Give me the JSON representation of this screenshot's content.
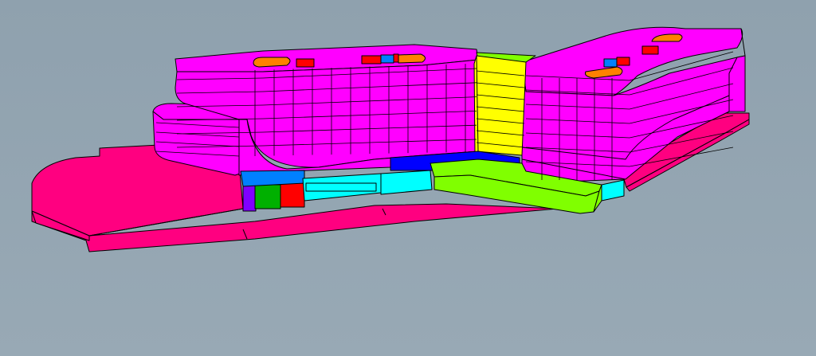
{
  "viewport": {
    "background_top": "#8fa1ae",
    "background_bottom": "#98a9b5"
  },
  "model": {
    "colors": {
      "office": "#ff00ff",
      "podium": "#ff0080",
      "circulation": "#ffff00",
      "retail": "#00ffff",
      "walkway": "#80ff00",
      "lobby": "#0000ff",
      "service": "#ff0000",
      "storage": "#00b000",
      "plant": "#0080ff",
      "roof_accent": "#ff8000",
      "utility": "#8000ff",
      "outline": "#000000"
    }
  }
}
